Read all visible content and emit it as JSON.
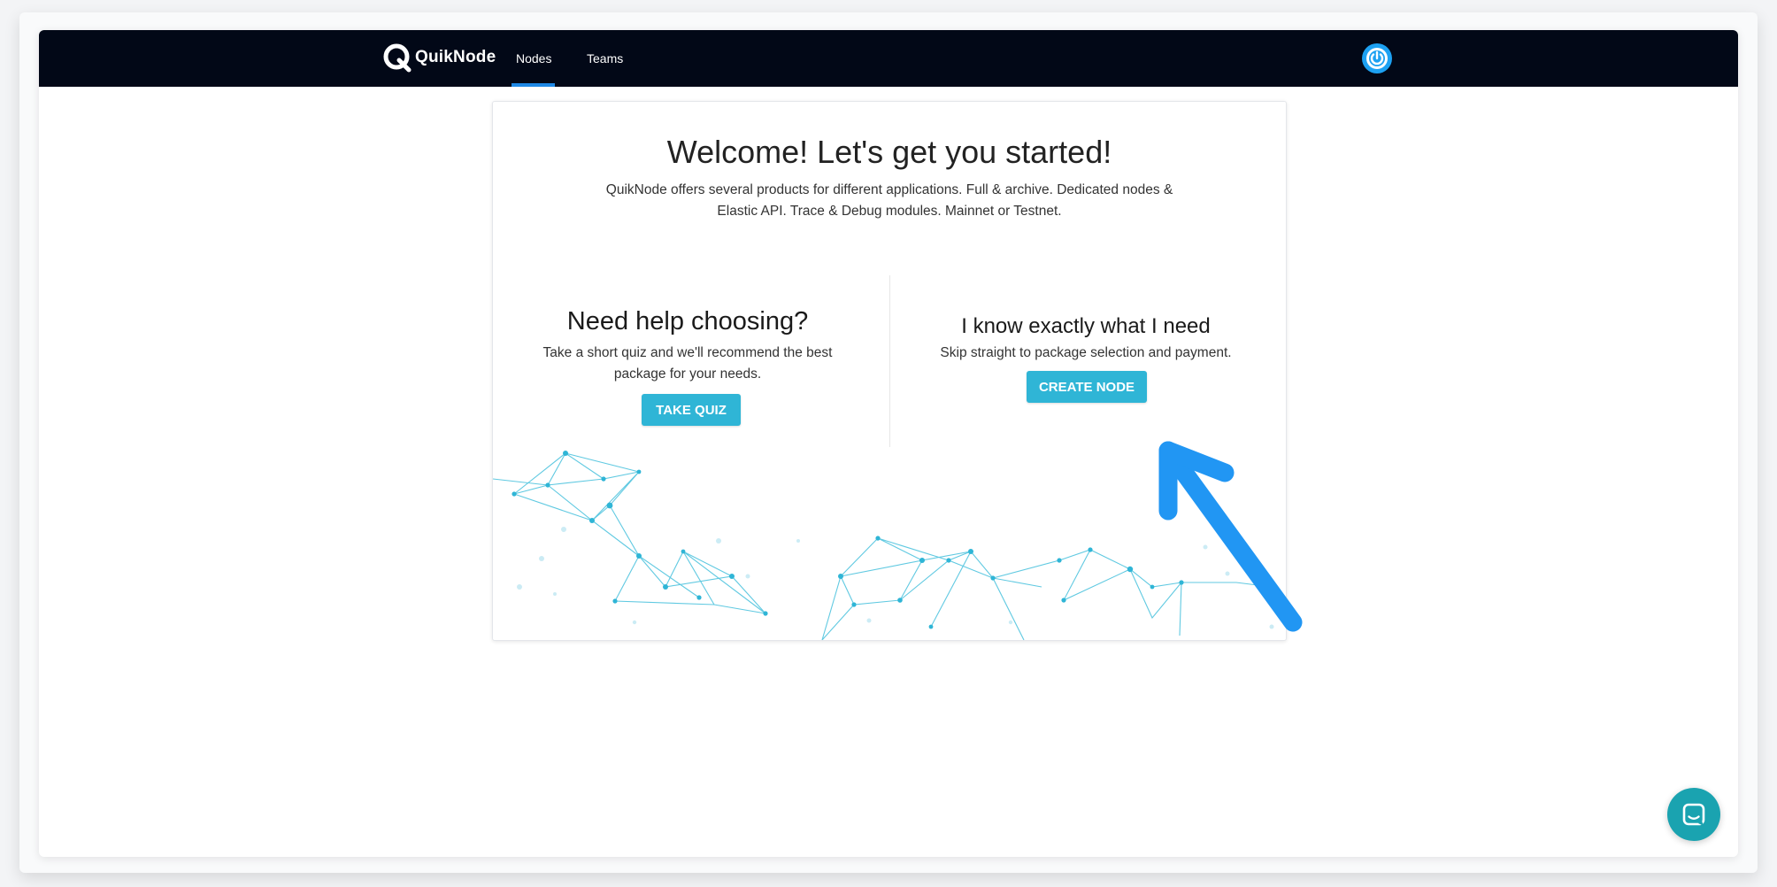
{
  "navbar": {
    "brand": "QuikNode",
    "links": [
      {
        "label": "Nodes",
        "active": true
      },
      {
        "label": "Teams",
        "active": false
      }
    ],
    "bg_color": "#020817",
    "accent_color": "#1e88e5"
  },
  "welcome": {
    "title": "Welcome! Let's get you started!",
    "description": "QuikNode offers several products for different applications. Full & archive. Dedicated nodes & Elastic API. Trace & Debug modules. Mainnet or Testnet."
  },
  "quiz": {
    "heading": "Need help choosing?",
    "text": "Take a short quiz and we'll recommend the best package for your needs.",
    "button": "TAKE QUIZ"
  },
  "create": {
    "heading": "I know exactly what I need",
    "text": "Skip straight to package selection and payment.",
    "button": "CREATE NODE"
  },
  "colors": {
    "button": "#2fb5d6",
    "arrow": "#2196f3",
    "chat": "#1aa3b0"
  }
}
